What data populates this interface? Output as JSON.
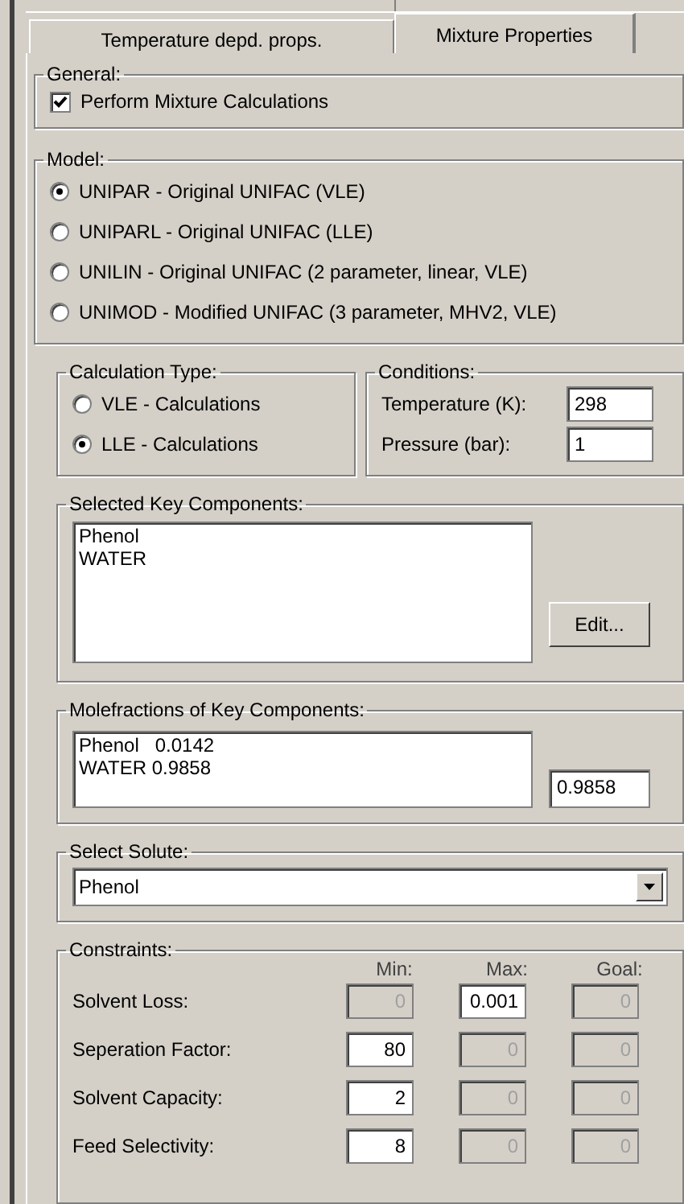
{
  "tabs": [
    {
      "label": "Temperature depd. props.",
      "selected": false
    },
    {
      "label": "Mixture Properties",
      "selected": true
    }
  ],
  "general": {
    "title": "General:",
    "checkbox": {
      "label": "Perform Mixture Calculations",
      "checked": true
    }
  },
  "model": {
    "title": "Model:",
    "options": [
      {
        "label": "UNIPAR - Original UNIFAC (VLE)",
        "selected": true
      },
      {
        "label": "UNIPARL - Original UNIFAC (LLE)",
        "selected": false
      },
      {
        "label": "UNILIN - Original UNIFAC (2 parameter, linear, VLE)",
        "selected": false
      },
      {
        "label": "UNIMOD - Modified UNIFAC (3 parameter, MHV2, VLE)",
        "selected": false
      }
    ]
  },
  "calculation_type": {
    "title": "Calculation Type:",
    "options": [
      {
        "label": "VLE - Calculations",
        "selected": false
      },
      {
        "label": "LLE - Calculations",
        "selected": true
      }
    ]
  },
  "conditions": {
    "title": "Conditions:",
    "fields": [
      {
        "label": "Temperature (K):",
        "value": "298"
      },
      {
        "label": "Pressure (bar):",
        "value": "1"
      }
    ]
  },
  "key_components": {
    "title": "Selected Key Components:",
    "items": [
      "Phenol",
      "WATER"
    ],
    "button": "Edit..."
  },
  "molefractions": {
    "title": "Molefractions of Key Components:",
    "items": [
      "Phenol   0.0142",
      "WATER 0.9858"
    ],
    "value": "0.9858"
  },
  "solute": {
    "title": "Select Solute:",
    "value": "Phenol"
  },
  "constraints": {
    "title": "Constraints:",
    "columns": [
      "Min:",
      "Max:",
      "Goal:"
    ],
    "rows": [
      {
        "label": "Solvent Loss:",
        "cells": [
          {
            "value": "0",
            "disabled": true
          },
          {
            "value": "0.001",
            "disabled": false
          },
          {
            "value": "0",
            "disabled": true
          }
        ]
      },
      {
        "label": "Seperation Factor:",
        "cells": [
          {
            "value": "80",
            "disabled": false
          },
          {
            "value": "0",
            "disabled": true
          },
          {
            "value": "0",
            "disabled": true
          }
        ]
      },
      {
        "label": "Solvent Capacity:",
        "cells": [
          {
            "value": "2",
            "disabled": false
          },
          {
            "value": "0",
            "disabled": true
          },
          {
            "value": "0",
            "disabled": true
          }
        ]
      },
      {
        "label": "Feed Selectivity:",
        "cells": [
          {
            "value": "8",
            "disabled": false
          },
          {
            "value": "0",
            "disabled": true
          },
          {
            "value": "0",
            "disabled": true
          }
        ]
      }
    ]
  }
}
